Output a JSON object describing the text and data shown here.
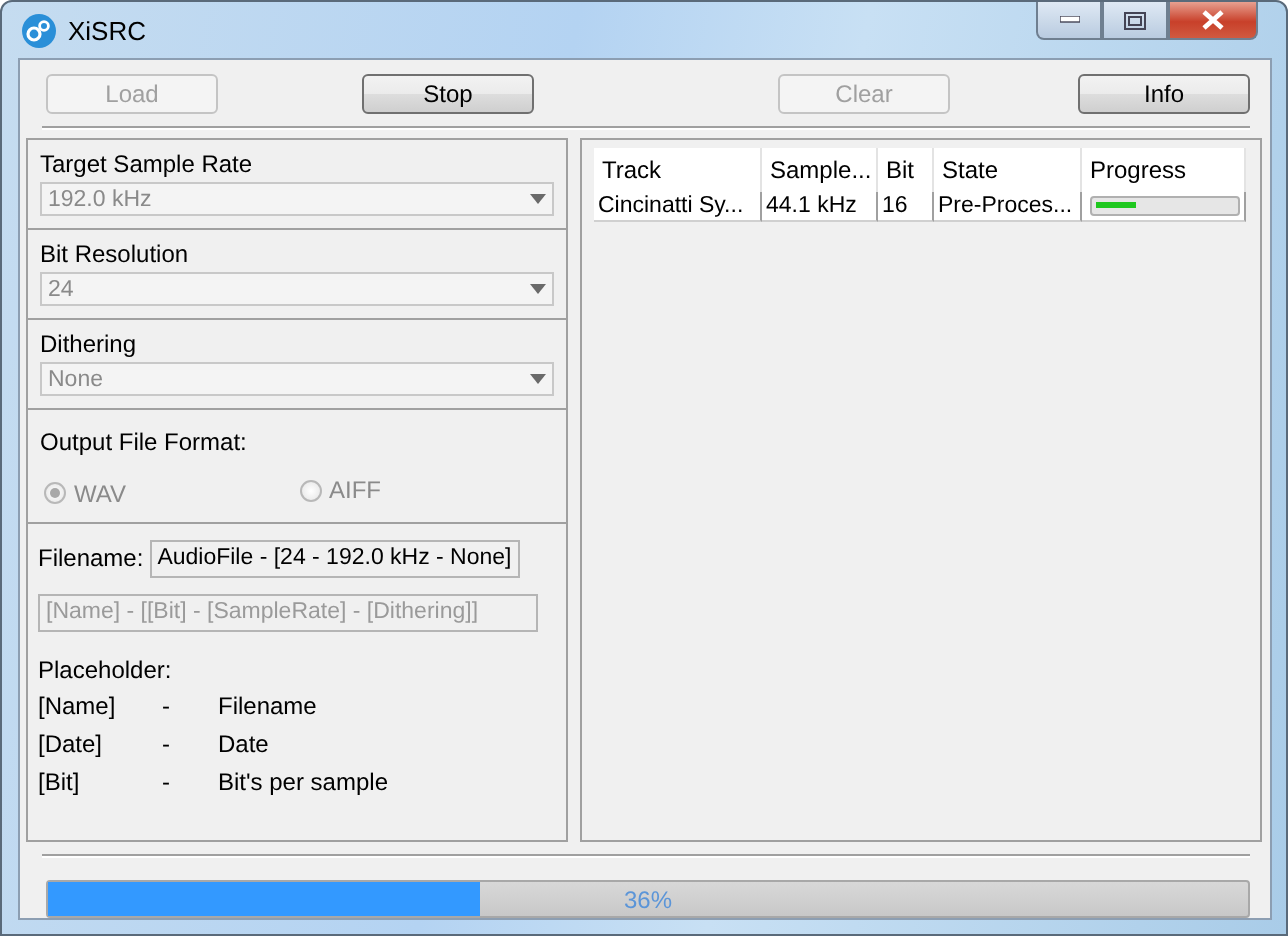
{
  "window": {
    "title": "XiSRC"
  },
  "toolbar": [
    {
      "label": "Load",
      "disabled": true
    },
    {
      "label": "Stop",
      "disabled": false
    },
    {
      "label": "Clear",
      "disabled": true
    },
    {
      "label": "Info",
      "disabled": false
    }
  ],
  "settings": {
    "combos": [
      {
        "label": "Target Sample Rate",
        "value": "192.0 kHz",
        "disabled": true
      },
      {
        "label": "Bit Resolution",
        "value": "24",
        "disabled": true
      },
      {
        "label": "Dithering",
        "value": "None",
        "disabled": true
      }
    ],
    "output_format": {
      "label": "Output File Format:",
      "options": [
        {
          "label": "WAV",
          "selected": true,
          "disabled": true
        },
        {
          "label": "AIFF",
          "selected": false,
          "disabled": true
        }
      ]
    },
    "filename": {
      "label": "Filename:",
      "value": "AudioFile - [24 - 192.0 kHz - None]"
    },
    "pattern": {
      "placeholder": "[Name] - [[Bit] - [SampleRate] - [Dithering]]"
    },
    "placeholders": {
      "title": "Placeholder:",
      "items": [
        {
          "token": "[Name]",
          "separator": "-",
          "meaning": "Filename"
        },
        {
          "token": "[Date]",
          "separator": "-",
          "meaning": "Date"
        },
        {
          "token": "[Bit]",
          "separator": "-",
          "meaning": "Bit's per sample"
        }
      ]
    }
  },
  "table": {
    "columns": [
      "Track",
      "Sample...",
      "Bit",
      "State",
      "Progress"
    ],
    "rows": [
      {
        "cells": [
          "Cincinatti Sy...",
          "44.1 kHz",
          "16",
          "Pre-Proces..."
        ],
        "level": 0.3
      }
    ]
  },
  "overall_progress": {
    "level": 0.36,
    "reading": "36%"
  }
}
